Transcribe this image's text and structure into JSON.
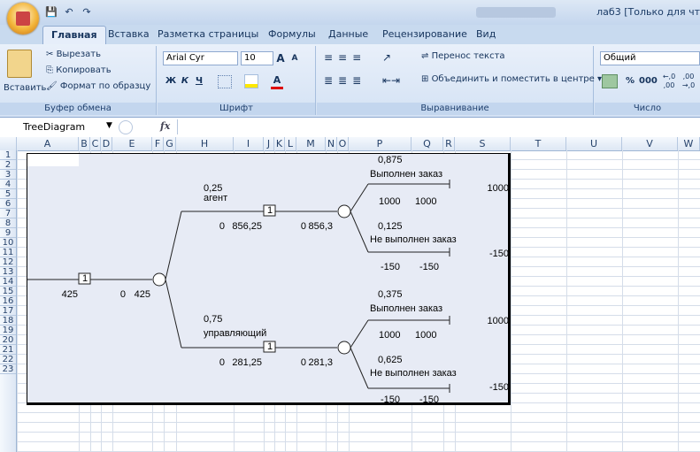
{
  "window": {
    "title": "лаб3 [Только для чт"
  },
  "quick_access": {
    "save": "💾",
    "undo": "↶",
    "redo": "↷"
  },
  "tabs": [
    "Главная",
    "Вставка",
    "Разметка страницы",
    "Формулы",
    "Данные",
    "Рецензирование",
    "Вид"
  ],
  "ribbon": {
    "clipboard": {
      "paste": "Вставить",
      "cut": "Вырезать",
      "copy": "Копировать",
      "format_painter": "Формат по образцу",
      "label": "Буфер обмена"
    },
    "font": {
      "name": "Arial Cyr",
      "size": "10",
      "grow": "A",
      "shrink": "A",
      "bold": "Ж",
      "italic": "К",
      "underline": "Ч",
      "label": "Шрифт"
    },
    "alignment": {
      "wrap": "Перенос текста",
      "merge": "Объединить и поместить в центре",
      "label": "Выравнивание"
    },
    "number": {
      "format": "Общий",
      "percent": "%",
      "thousands": "000",
      "inc": "←,0 ,00",
      "dec": ",00 →,0",
      "label": "Число"
    }
  },
  "formula_bar": {
    "name_box": "TreeDiagram",
    "fx": "fx",
    "value": ""
  },
  "columns": [
    "A",
    "B",
    "C",
    "D",
    "E",
    "F",
    "G",
    "H",
    "I",
    "J",
    "K",
    "L",
    "M",
    "N",
    "O",
    "P",
    "Q",
    "R",
    "S",
    "T",
    "U",
    "V",
    "W"
  ],
  "rows": [
    "1",
    "2",
    "3",
    "4",
    "5",
    "6",
    "7",
    "8",
    "9",
    "10",
    "11",
    "12",
    "13",
    "14",
    "15",
    "16",
    "17",
    "18",
    "19",
    "20",
    "21",
    "22",
    "23"
  ],
  "tree": {
    "root_value": "425",
    "root_zero": "0",
    "root_result": "425",
    "root_decision_num": "1",
    "agent": {
      "prob": "0,25",
      "label": "агент",
      "zero": "0",
      "value": "856,25",
      "zero2": "0",
      "value2": "856,3",
      "decision_num": "1"
    },
    "manager": {
      "prob": "0,75",
      "label": "управляющий",
      "zero": "0",
      "value": "281,25",
      "zero2": "0",
      "value2": "281,3",
      "decision_num": "1"
    },
    "agent_done": {
      "prob": "0,875",
      "label": "Выполнен заказ",
      "a": "1000",
      "b": "1000",
      "payoff": "1000"
    },
    "agent_fail": {
      "prob": "0,125",
      "label": "Не выполнен заказ",
      "a": "-150",
      "b": "-150",
      "payoff": "-150"
    },
    "manager_done": {
      "prob": "0,375",
      "label": "Выполнен заказ",
      "a": "1000",
      "b": "1000",
      "payoff": "1000"
    },
    "manager_fail": {
      "prob": "0,625",
      "label": "Не выполнен заказ",
      "a": "-150",
      "b": "-150",
      "payoff": "-150"
    }
  }
}
